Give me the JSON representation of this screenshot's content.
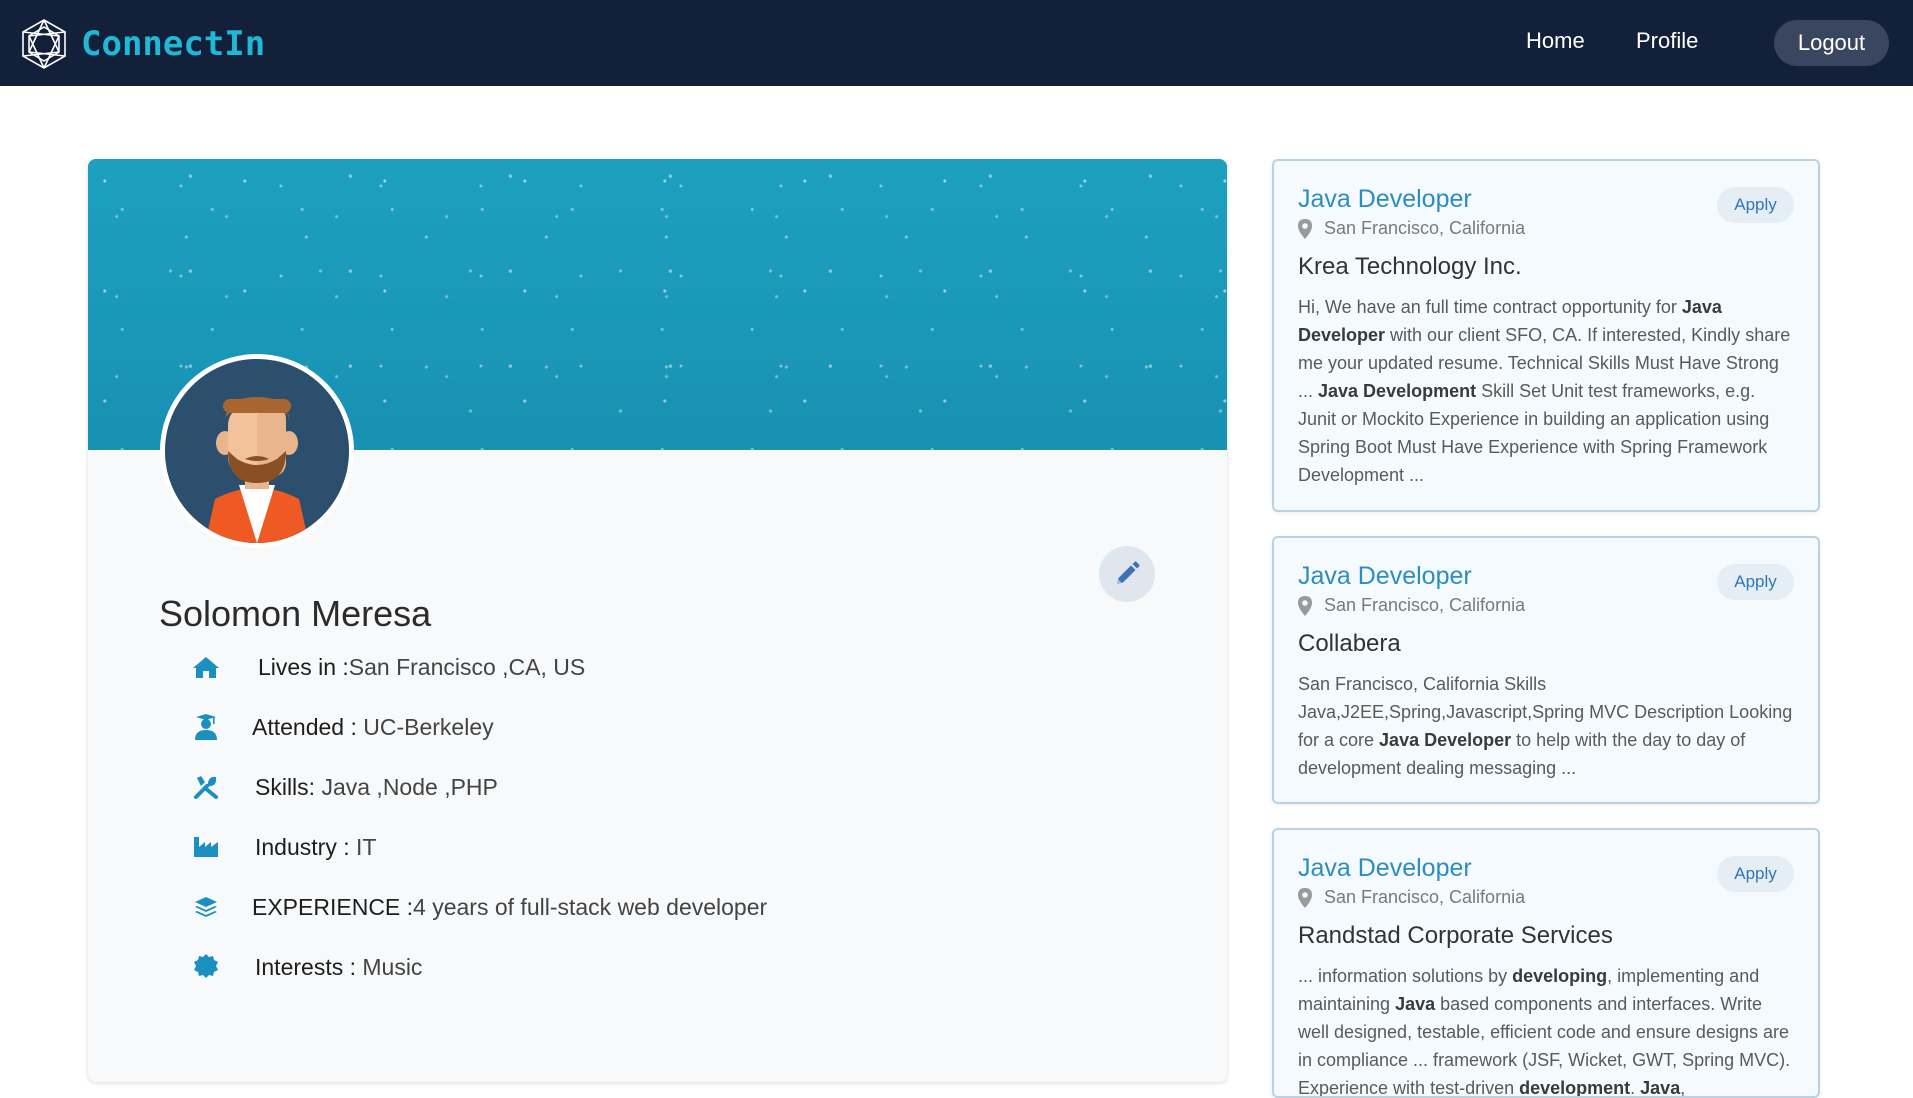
{
  "navbar": {
    "brand": "ConnectIn",
    "links": [
      "Home",
      "Profile"
    ],
    "logout": "Logout"
  },
  "profile": {
    "name": "Solomon Meresa",
    "details": [
      {
        "icon": "home-icon",
        "label": "Lives in :",
        "value": "San Francisco ,CA, US"
      },
      {
        "icon": "graduate-icon",
        "label": "Attended : ",
        "value": "UC-Berkeley"
      },
      {
        "icon": "tools-icon",
        "label": "Skills: ",
        "value": "Java ,Node ,PHP"
      },
      {
        "icon": "industry-icon",
        "label": "Industry : ",
        "value": "IT"
      },
      {
        "icon": "layers-icon",
        "label": "EXPERIENCE :",
        "value": "4 years of full-stack web developer"
      },
      {
        "icon": "badge-icon",
        "label": "Interests : ",
        "value": "Music"
      }
    ]
  },
  "jobs": [
    {
      "title": "Java Developer",
      "apply": "Apply",
      "location": "San Francisco, California",
      "company": "Krea Technology Inc.",
      "desc_parts": [
        {
          "t": "Hi, We have an full time contract opportunity for "
        },
        {
          "t": "Java Developer",
          "b": true
        },
        {
          "t": " with our client SFO, CA. If interested, Kindly share me your updated resume. Technical Skills Must Have Strong ... "
        },
        {
          "t": "Java Development",
          "b": true
        },
        {
          "t": " Skill Set Unit test frameworks, e.g. Junit or Mockito Experience in building an application using Spring Boot Must Have Experience with Spring Framework Development ..."
        }
      ]
    },
    {
      "title": "Java Developer",
      "apply": "Apply",
      "location": "San Francisco, California",
      "company": "Collabera",
      "desc_parts": [
        {
          "t": "San Francisco, California Skills Java,J2EE,Spring,Javascript,Spring MVC Description Looking for a core "
        },
        {
          "t": "Java Developer",
          "b": true
        },
        {
          "t": " to help with the day to day of development dealing messaging ..."
        }
      ]
    },
    {
      "title": "Java Developer",
      "apply": "Apply",
      "location": "San Francisco, California",
      "company": "Randstad Corporate Services",
      "desc_parts": [
        {
          "t": "... information solutions by "
        },
        {
          "t": "developing",
          "b": true
        },
        {
          "t": ", implementing and maintaining "
        },
        {
          "t": "Java",
          "b": true
        },
        {
          "t": " based components and interfaces. Write well designed, testable, efficient code and ensure designs are in compliance ... framework (JSF, Wicket, GWT, Spring MVC). Experience with test-driven "
        },
        {
          "t": "development",
          "b": true
        },
        {
          "t": ". "
        },
        {
          "t": "Java",
          "b": true
        },
        {
          "t": ","
        }
      ]
    }
  ],
  "colors": {
    "navbar": "#13203a",
    "brand": "#1fb8d6",
    "accent": "#1a9abb",
    "job_title": "#2d8dbf",
    "icon": "#1a8fc0"
  }
}
